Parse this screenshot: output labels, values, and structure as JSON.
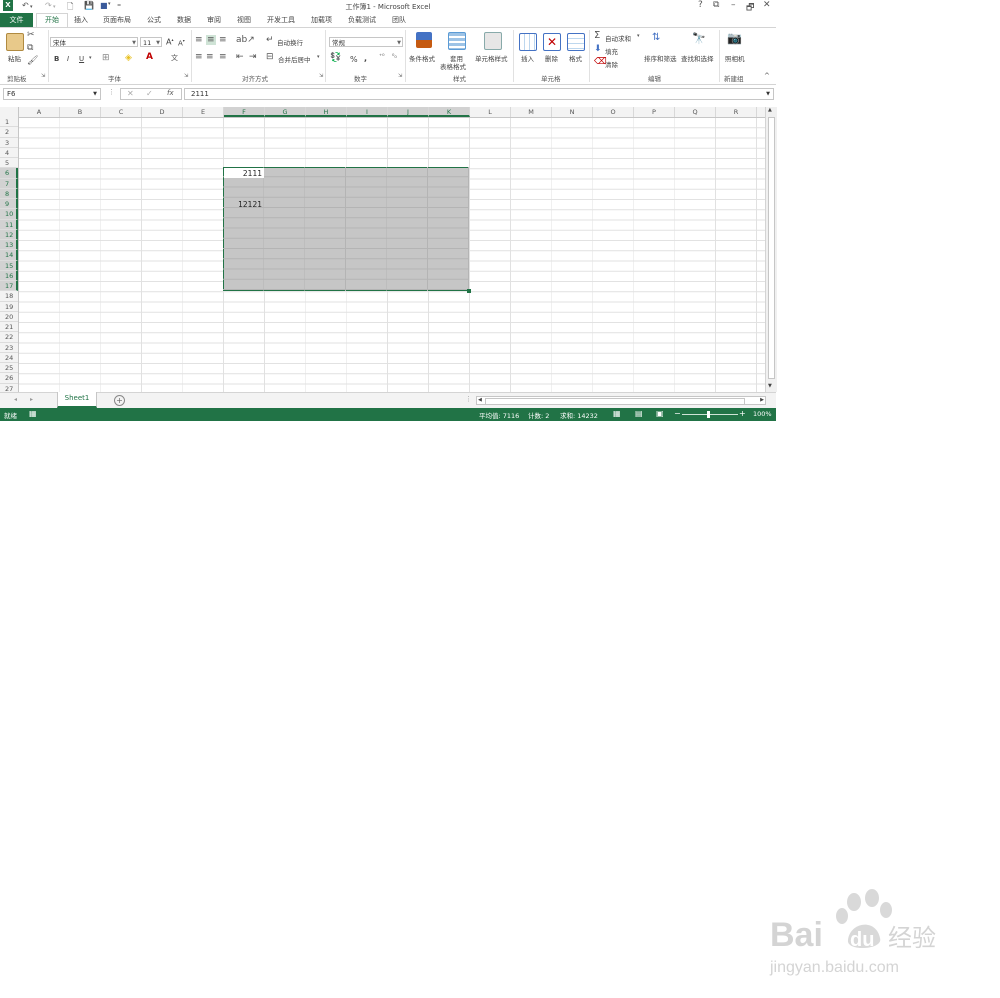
{
  "window": {
    "title": "工作簿1 - Microsoft Excel",
    "controls": [
      "?",
      "⧉",
      "–",
      "🗗",
      "✕"
    ]
  },
  "tabs": [
    "文件",
    "开始",
    "插入",
    "页面布局",
    "公式",
    "数据",
    "审阅",
    "视图",
    "开发工具",
    "加载项",
    "负载测试",
    "团队"
  ],
  "ribbon": {
    "groups": {
      "clipboard": "剪贴板",
      "font": "字体",
      "alignment": "对齐方式",
      "number": "数字",
      "styles": "样式",
      "cells": "单元格",
      "editing": "编辑",
      "new_group": "新建组"
    },
    "paste_label": "粘贴",
    "font_name": "宋体",
    "font_size": "11",
    "bold": "B",
    "italic": "I",
    "underline": "U",
    "wrap_text": "自动换行",
    "merge_center": "合并后居中",
    "number_format": "常规",
    "percent": "%",
    "comma": ",",
    "conditional_format": "条件格式",
    "format_table_1": "套用",
    "format_table_2": "表格格式",
    "cell_styles": "单元格样式",
    "insert": "插入",
    "delete": "删除",
    "format": "格式",
    "autosum": "自动求和",
    "fill": "填充",
    "clear": "清除",
    "sort_filter": "排序和筛选",
    "find_select": "查找和选择",
    "camera": "照相机"
  },
  "formula_bar": {
    "name_box": "F6",
    "formula": "2111",
    "fx": "fx"
  },
  "columns": [
    "A",
    "B",
    "C",
    "D",
    "E",
    "F",
    "G",
    "H",
    "I",
    "J",
    "K",
    "L",
    "M",
    "N",
    "O",
    "P",
    "Q",
    "R"
  ],
  "selected_columns": [
    "F",
    "G",
    "H",
    "I",
    "J",
    "K"
  ],
  "rows": [
    "1",
    "2",
    "3",
    "4",
    "5",
    "6",
    "7",
    "8",
    "9",
    "10",
    "11",
    "12",
    "13",
    "14",
    "15",
    "16",
    "17",
    "18",
    "19",
    "20",
    "21",
    "22",
    "23",
    "24",
    "25",
    "26",
    "27"
  ],
  "selected_rows": [
    "6",
    "7",
    "8",
    "9",
    "10",
    "11",
    "12",
    "13",
    "14",
    "15",
    "16",
    "17"
  ],
  "cells": {
    "F6": "2111",
    "F9": "12121"
  },
  "sheet_tabs": [
    "Sheet1"
  ],
  "status": {
    "ready": "就绪",
    "average": "平均值: 7116",
    "count": "计数: 2",
    "sum": "求和: 14232",
    "zoom": "100%"
  },
  "watermark": {
    "brand": "Bai du 经验",
    "url": "jingyan.baidu.com"
  },
  "colors": {
    "accent": "#217346",
    "selection": "#c6c6c6"
  }
}
